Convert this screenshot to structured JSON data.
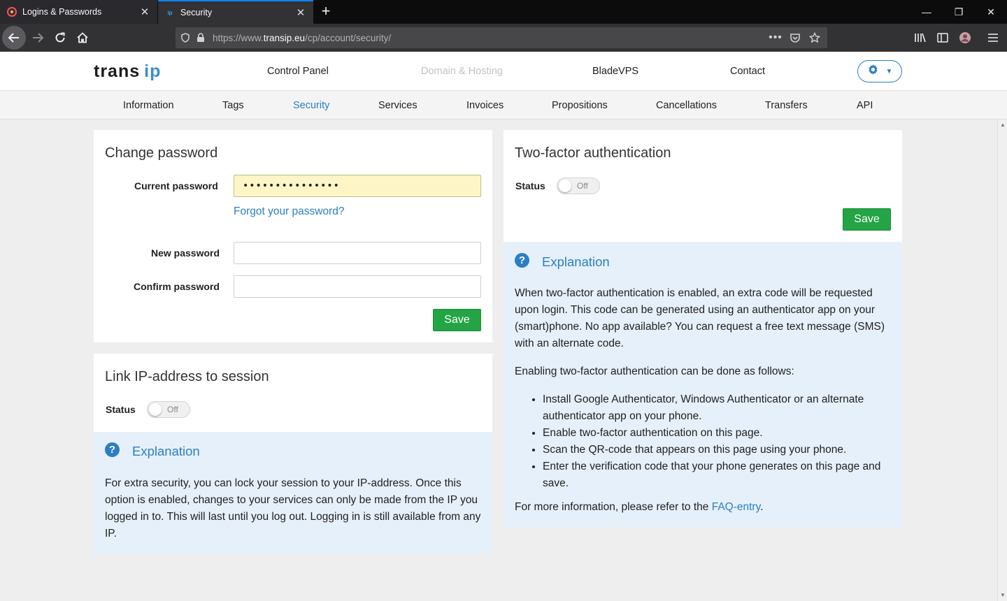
{
  "browser": {
    "tabs": [
      {
        "title": "Logins & Passwords",
        "favicon": "lock-icon"
      },
      {
        "title": "Security",
        "favicon": "ip"
      }
    ],
    "url_prefix": "https://www.",
    "url_host": "transip.eu",
    "url_path": "/cp/account/security/"
  },
  "header": {
    "logo_main": "trans",
    "logo_accent": "ip",
    "nav": [
      "Control Panel",
      "Domain & Hosting",
      "BladeVPS",
      "Contact"
    ]
  },
  "subnav": [
    "Information",
    "Tags",
    "Security",
    "Services",
    "Invoices",
    "Propositions",
    "Cancellations",
    "Transfers",
    "API"
  ],
  "change_password": {
    "title": "Change password",
    "current_label": "Current password",
    "current_value": "•••••••••••••••",
    "forgot_link": "Forgot your password?",
    "new_label": "New password",
    "confirm_label": "Confirm password",
    "save": "Save"
  },
  "link_ip": {
    "title": "Link IP-address to session",
    "status_label": "Status",
    "toggle": "Off",
    "explanation_title": "Explanation",
    "explanation_text": "For extra security, you can lock your session to your IP-address. Once this option is enabled, changes to your services can only be made from the IP you logged in to. This will last until you log out. Logging in is still available from any IP."
  },
  "two_factor": {
    "title": "Two-factor authentication",
    "status_label": "Status",
    "toggle": "Off",
    "save": "Save",
    "explanation_title": "Explanation",
    "para1": "When two-factor authentication is enabled, an extra code will be requested upon login. This code can be generated using an authenticator app on your (smart)phone. No app available? You can request a free text message (SMS) with an alternate code.",
    "para2": "Enabling two-factor authentication can be done as follows:",
    "steps": [
      "Install Google Authenticator, Windows Authenticator or an alternate authenticator app on your phone.",
      "Enable two-factor authentication on this page.",
      "Scan the QR-code that appears on this page using your phone.",
      "Enter the verification code that your phone generates on this page and save."
    ],
    "more_info_prefix": "For more information, please refer to the ",
    "more_info_link": "FAQ-entry",
    "more_info_suffix": "."
  }
}
